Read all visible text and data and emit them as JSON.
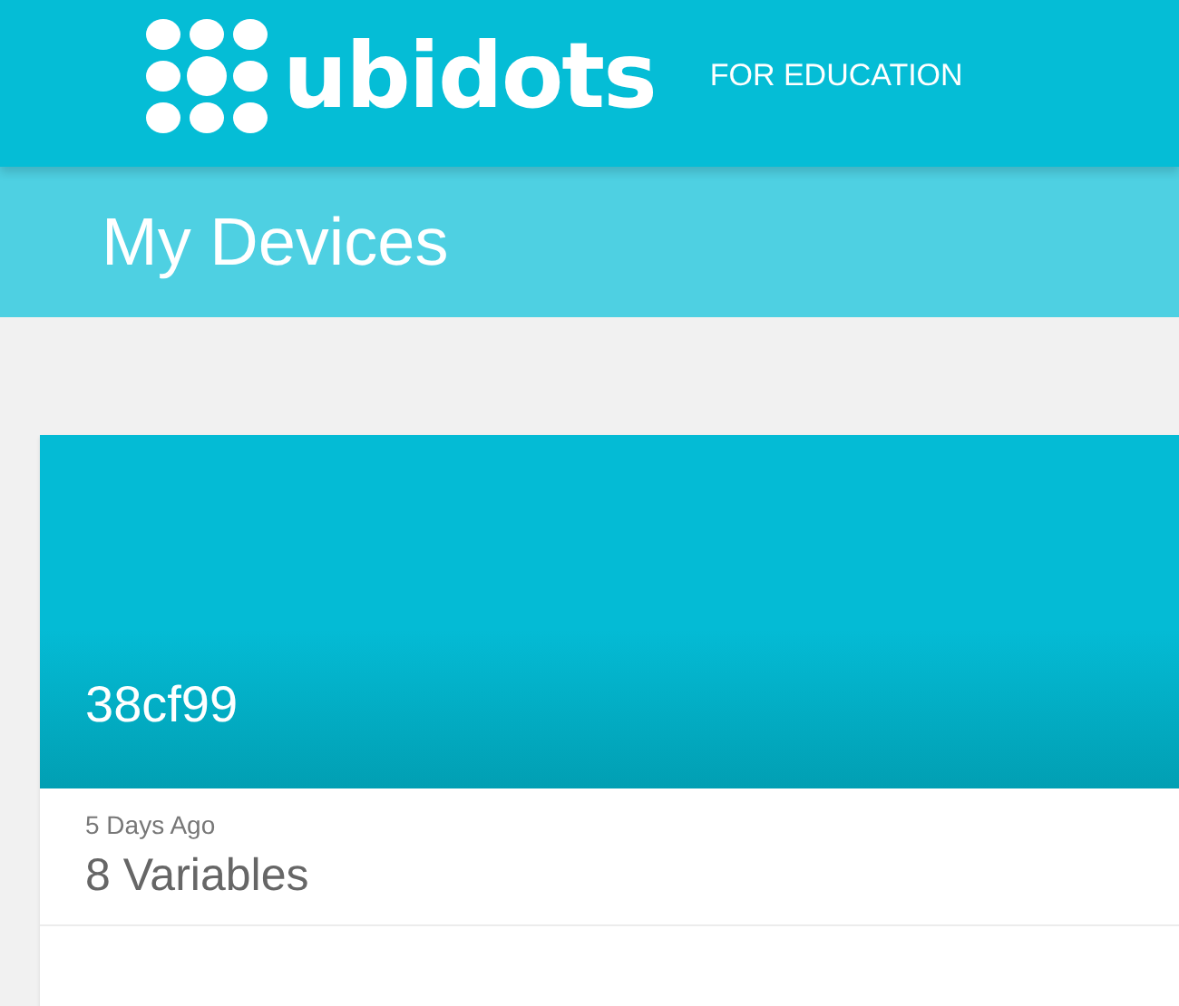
{
  "header": {
    "logo_text": "ubidots",
    "edition": "FOR EDUCATION"
  },
  "page_title": "My Devices",
  "devices": [
    {
      "name": "38cf99",
      "last_activity": "5 Days Ago",
      "variables": "8 Variables"
    }
  ]
}
